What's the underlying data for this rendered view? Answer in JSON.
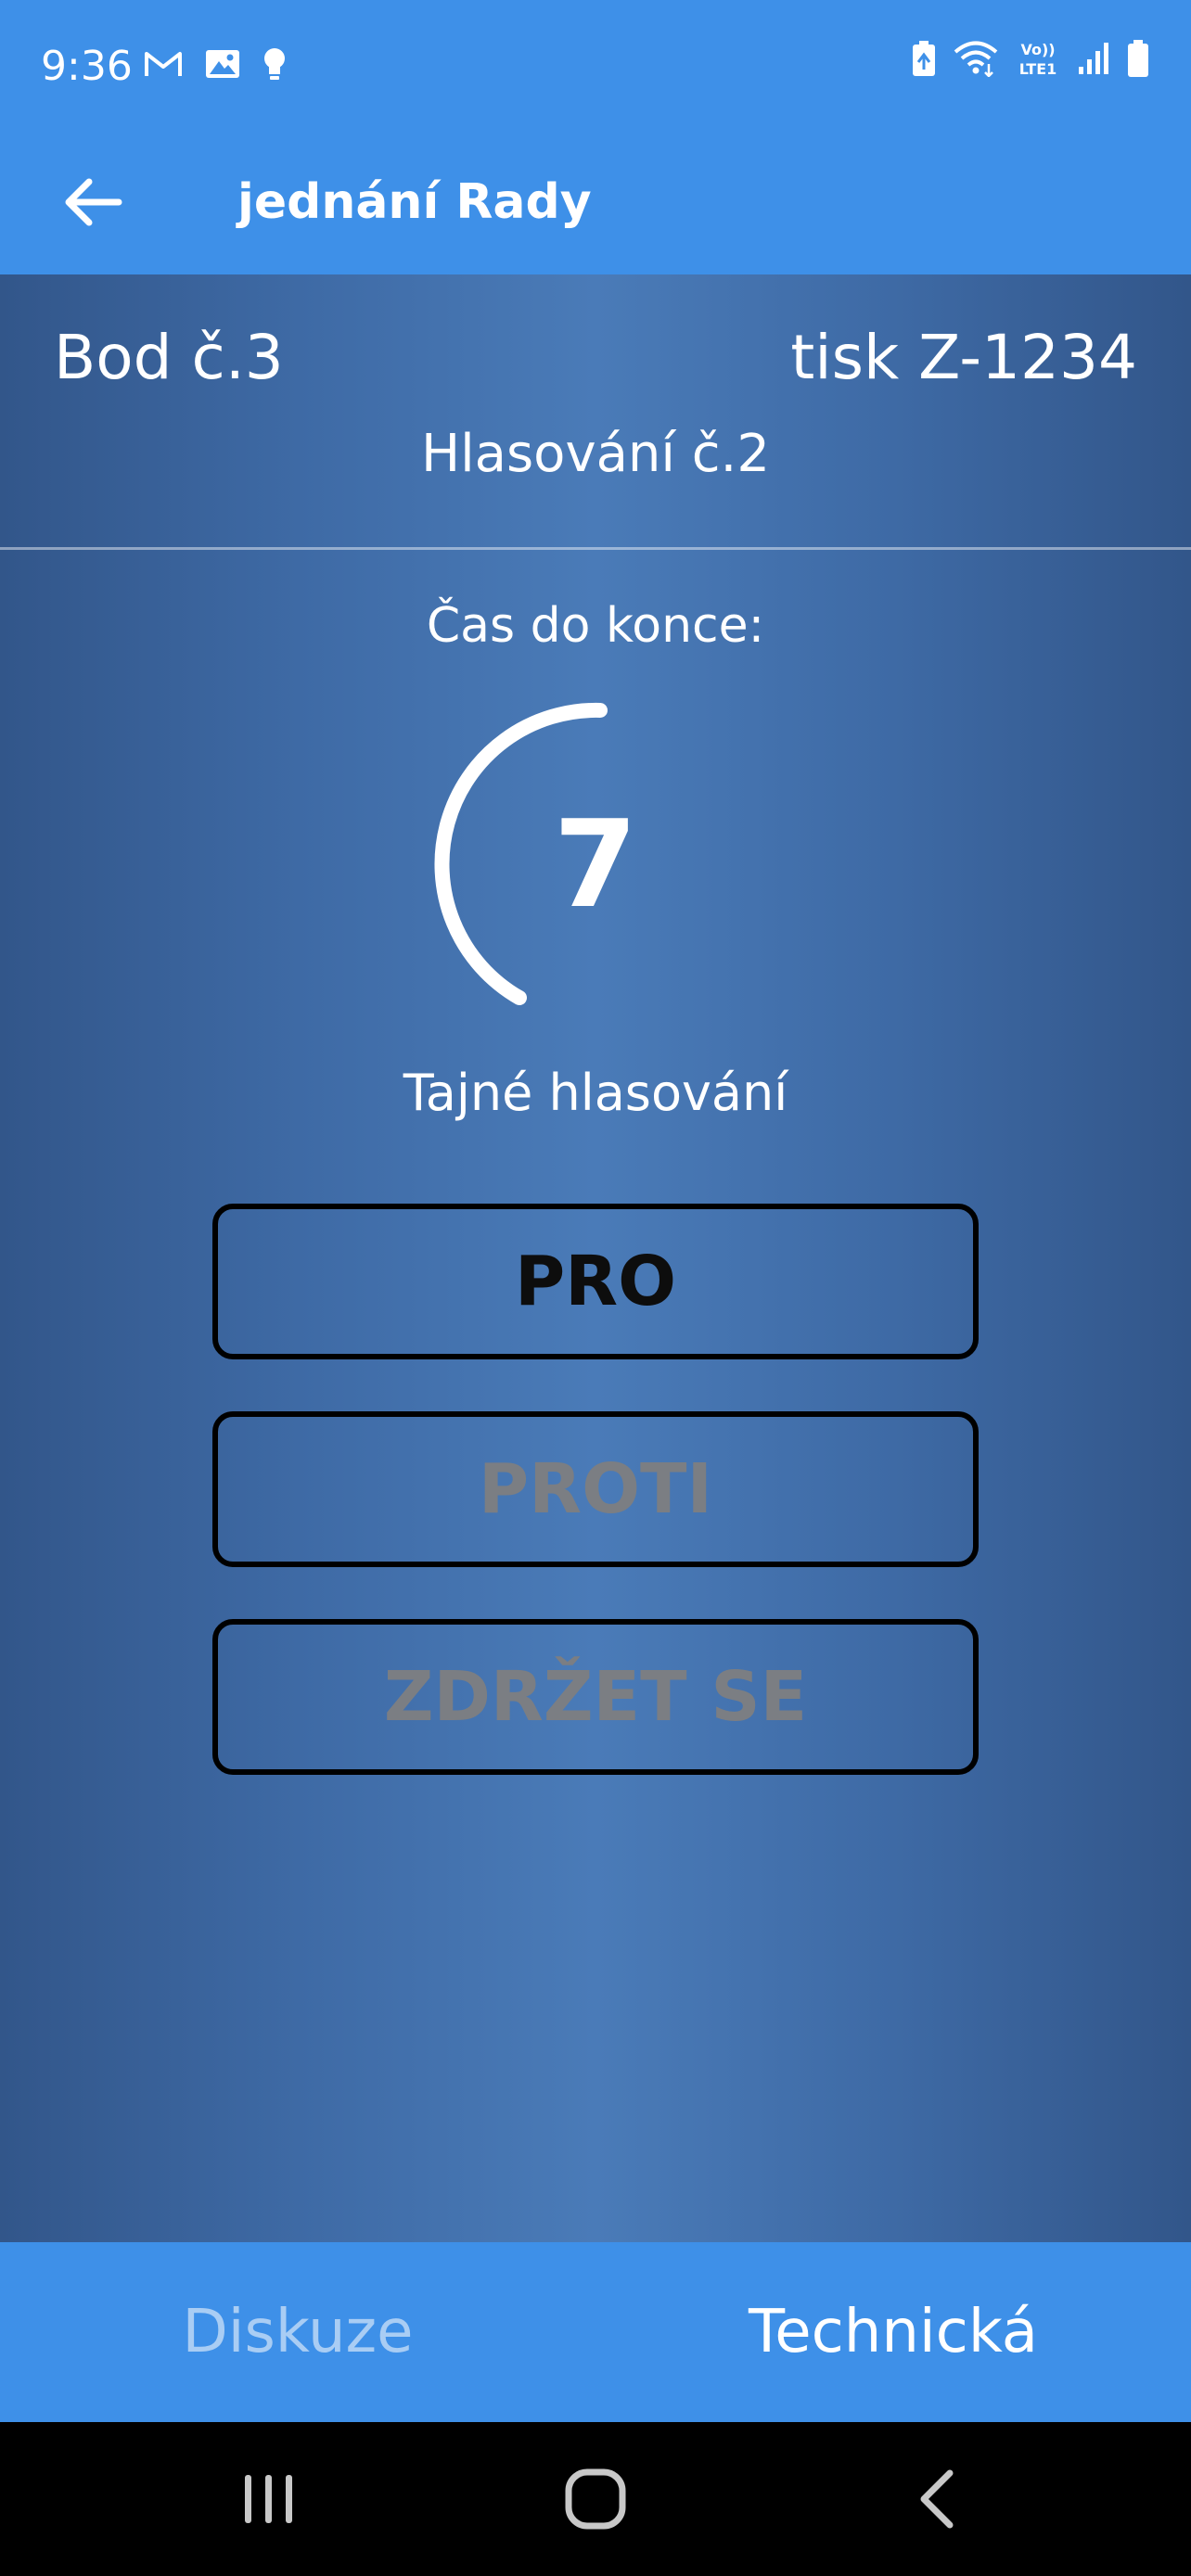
{
  "status_bar": {
    "time": "9:36",
    "left_icons": [
      "gmail-icon",
      "gallery-icon",
      "bulb-icon"
    ],
    "right_icons": [
      "battery-saver-icon",
      "wifi-icon",
      "volte-icon",
      "signal-icon",
      "battery-icon"
    ],
    "volte_text_top": "Vo))",
    "volte_text_bottom": "LTE1"
  },
  "app_bar": {
    "title": "jednání Rady",
    "back_icon": "arrow-left-icon"
  },
  "vote_panel": {
    "item": "Bod č.3",
    "print": "tisk Z-1234",
    "vote_number": "Hlasování č.2",
    "timer_label": "Čas do konce:",
    "timer_value": "7",
    "vote_type": "Tajné hlasování"
  },
  "buttons": {
    "pro": "PRO",
    "proti": "PROTI",
    "abstain": "ZDRŽET SE"
  },
  "bottom_nav": {
    "tabs": [
      {
        "label": "Diskuze",
        "active": false
      },
      {
        "label": "Technická",
        "active": true
      }
    ]
  },
  "system_nav": {
    "icons": [
      "recent-apps-icon",
      "home-icon",
      "back-icon"
    ]
  },
  "colors": {
    "app_blue": "#3e90e8",
    "panel_dark": "#32568a",
    "panel_light": "#4a7bb8",
    "disabled_text": "#7b7e83",
    "inactive_tab": "#a9cdf4"
  }
}
